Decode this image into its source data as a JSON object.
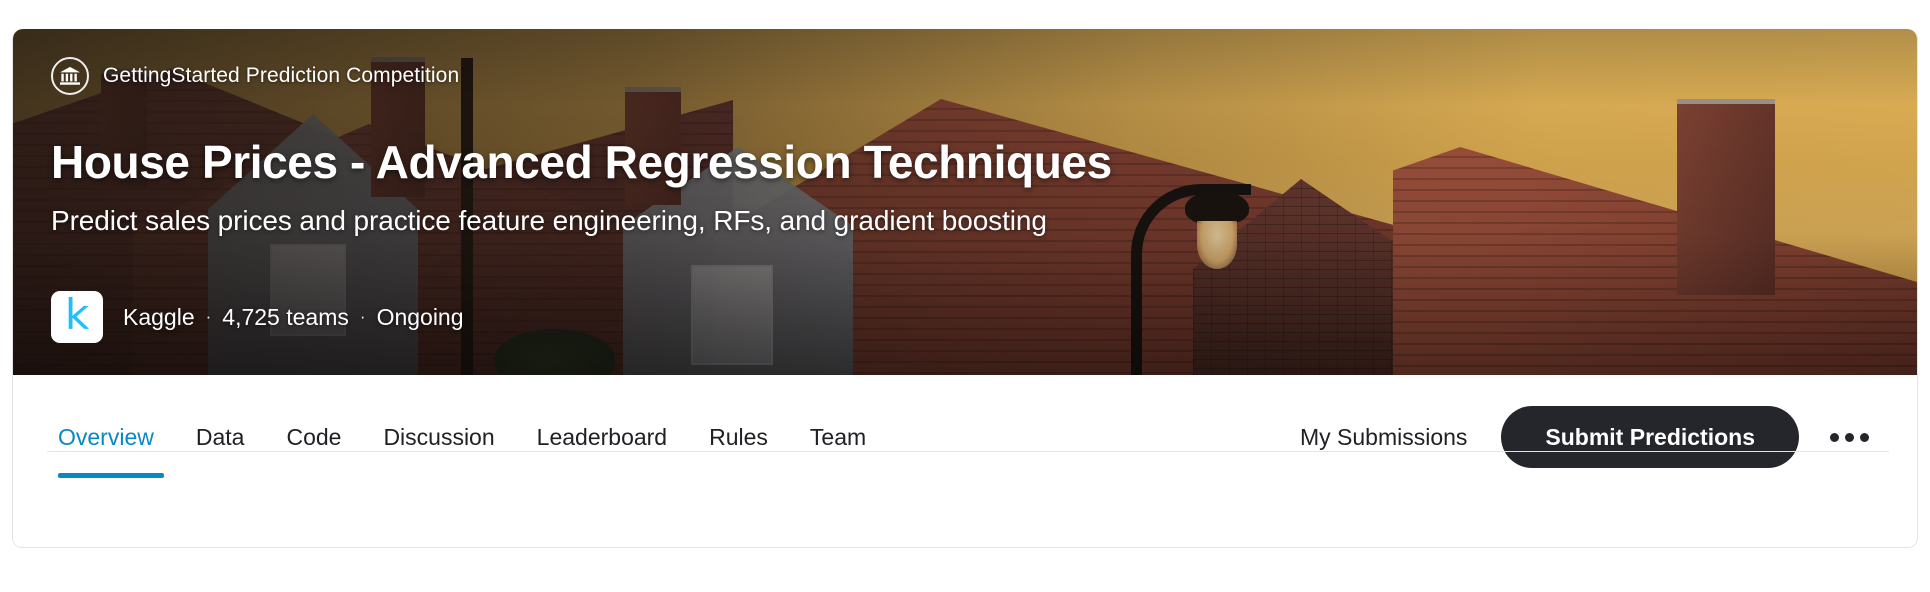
{
  "hero": {
    "badge": {
      "icon": "bank-icon",
      "label": "GettingStarted Prediction Competition"
    },
    "title": "House Prices - Advanced Regression Techniques",
    "subtitle": "Predict sales prices and practice feature engineering, RFs, and gradient boosting",
    "organizer": {
      "logo_letter": "k",
      "name": "Kaggle"
    },
    "separator": "·",
    "teams": "4,725 teams",
    "status": "Ongoing"
  },
  "nav": {
    "tabs": [
      {
        "label": "Overview",
        "active": true
      },
      {
        "label": "Data",
        "active": false
      },
      {
        "label": "Code",
        "active": false
      },
      {
        "label": "Discussion",
        "active": false
      },
      {
        "label": "Leaderboard",
        "active": false
      },
      {
        "label": "Rules",
        "active": false
      },
      {
        "label": "Team",
        "active": false
      }
    ],
    "my_submissions_label": "My Submissions",
    "submit_label": "Submit Predictions",
    "more_icon": "ellipsis-horizontal-icon"
  },
  "colors": {
    "accent": "#0a88c4",
    "kaggle_cyan": "#20beff",
    "submit_button_bg": "#25262b",
    "text_primary": "#202124",
    "border": "#e2e4e6"
  }
}
